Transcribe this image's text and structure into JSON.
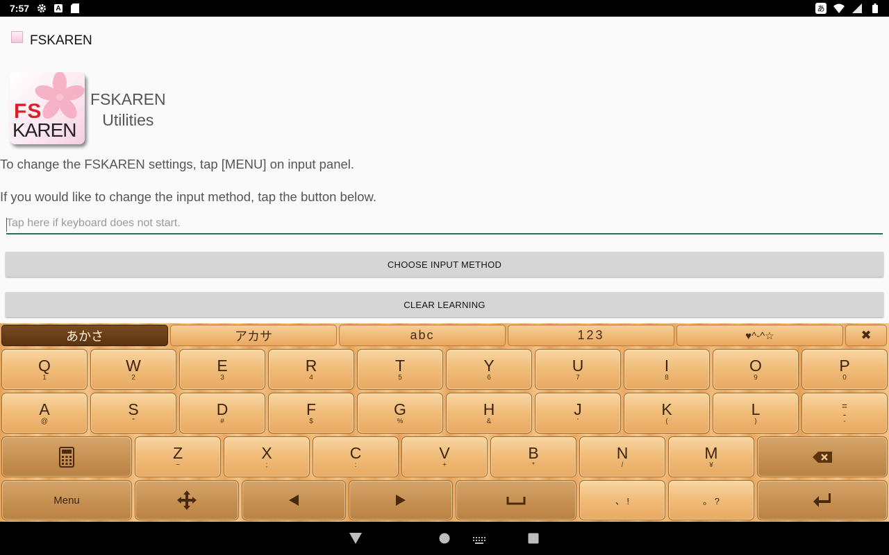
{
  "status": {
    "time": "7:57",
    "ime_glyph": "あ"
  },
  "app": {
    "title": "FSKAREN"
  },
  "logo": {
    "fs": "FS",
    "karen": "KAREN",
    "line1": "FSKAREN",
    "line2": "Utilities"
  },
  "desc": {
    "line1": "To change the FSKAREN settings, tap [MENU] on input panel.",
    "line2": "If you would like to change the input method, tap the button below."
  },
  "input": {
    "placeholder": "Tap here if keyboard does not start."
  },
  "buttons": {
    "choose": "CHOOSE INPUT METHOD",
    "clear": "CLEAR LEARNING"
  },
  "keyboard": {
    "tabs": [
      {
        "label": "あかさ"
      },
      {
        "label": "アカサ"
      },
      {
        "label": "abc"
      },
      {
        "label": "123"
      },
      {
        "label": "♥^-^☆"
      }
    ],
    "close": "✖",
    "row1": [
      {
        "k": "Q",
        "s": "1"
      },
      {
        "k": "W",
        "s": "2"
      },
      {
        "k": "E",
        "s": "3"
      },
      {
        "k": "R",
        "s": "4"
      },
      {
        "k": "T",
        "s": "5"
      },
      {
        "k": "Y",
        "s": "6"
      },
      {
        "k": "U",
        "s": "7"
      },
      {
        "k": "I",
        "s": "8"
      },
      {
        "k": "O",
        "s": "9"
      },
      {
        "k": "P",
        "s": "0"
      }
    ],
    "row2": [
      {
        "k": "A",
        "s": "@"
      },
      {
        "k": "S",
        "s": "\""
      },
      {
        "k": "D",
        "s": "#"
      },
      {
        "k": "F",
        "s": "$"
      },
      {
        "k": "G",
        "s": "%"
      },
      {
        "k": "H",
        "s": "&"
      },
      {
        "k": "J",
        "s": "'"
      },
      {
        "k": "K",
        "s": "("
      },
      {
        "k": "L",
        "s": ")"
      },
      {
        "k": "=\n-",
        "s": "-"
      }
    ],
    "row3": [
      {
        "k": "Z",
        "s": "~"
      },
      {
        "k": "X",
        "s": ";"
      },
      {
        "k": "C",
        "s": ":"
      },
      {
        "k": "V",
        "s": "+"
      },
      {
        "k": "B",
        "s": "*"
      },
      {
        "k": "N",
        "s": "/"
      },
      {
        "k": "M",
        "s": "¥"
      }
    ],
    "menu": "Menu",
    "punct1": "、 !",
    "punct2": "。 ?"
  }
}
